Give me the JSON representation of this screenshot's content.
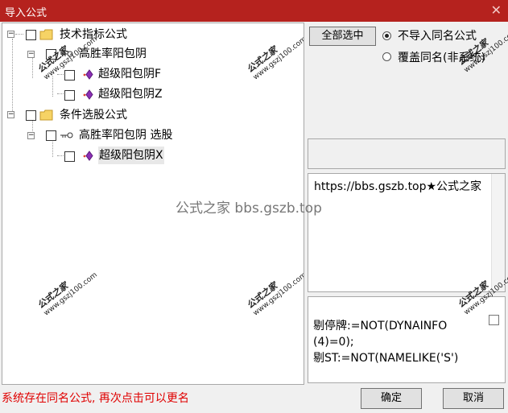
{
  "window": {
    "title": "导入公式",
    "close_symbol": "✕"
  },
  "tree": {
    "root1": {
      "label": "技术指标公式"
    },
    "child1": {
      "label": "高胜率阳包阴"
    },
    "leaf1": {
      "label": "超级阳包阴F"
    },
    "leaf2": {
      "label": "超级阳包阴Z"
    },
    "root2": {
      "label": "条件选股公式"
    },
    "child2": {
      "label": "高胜率阳包阴  选股"
    },
    "leaf3": {
      "label": "超级阳包阴X"
    }
  },
  "buttons": {
    "select_all": "全部选中",
    "ok": "确定",
    "cancel": "取消"
  },
  "options": {
    "no_import": "不导入同名公式",
    "overwrite": "覆盖同名(非系统)",
    "selected": "no_import"
  },
  "desc": {
    "text": "https://bbs.gszb.top★公式之家"
  },
  "code": {
    "line1": "剔停牌:=NOT(DYNAINFO",
    "line2": "(4)=0);",
    "line3": "剔ST:=NOT(NAMELIKE('S')"
  },
  "status": {
    "text": "系统存在同名公式, 再次点击可以更名"
  },
  "watermark": {
    "center": "公式之家 bbs.gszb.top",
    "stamp_cn": "公式之家",
    "stamp_url": "www.gszj100.com"
  },
  "colors": {
    "titlebar": "#b5221e",
    "status_text": "#e00000"
  },
  "icons": {
    "folder": "folder-icon",
    "key": "key-icon",
    "diamond": "purple-diamond-icon",
    "collapse": "collapse-box-icon"
  }
}
